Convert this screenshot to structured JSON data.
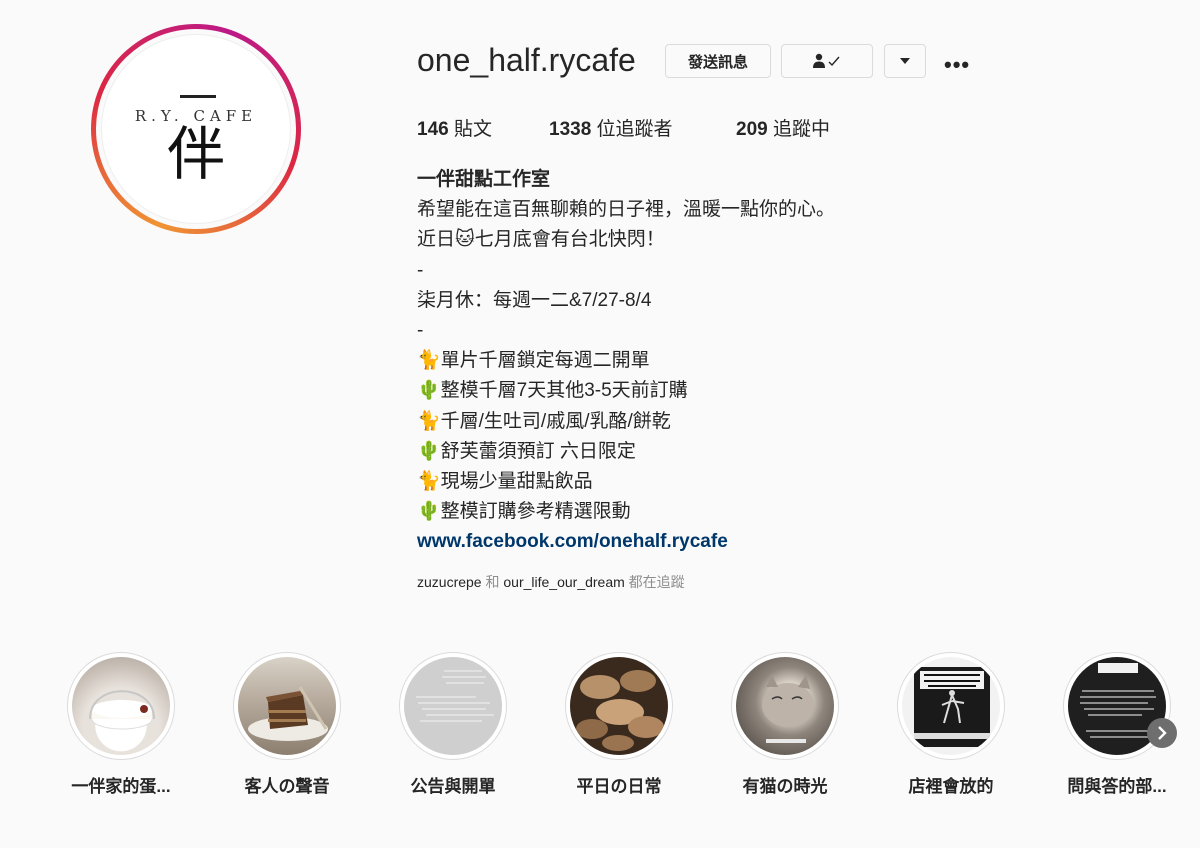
{
  "profile": {
    "username": "one_half.rycafe",
    "avatar_text": {
      "brand": "R.Y. CAFE",
      "char": "伴"
    },
    "buttons": {
      "message": "發送訊息",
      "following_icon": "person-check-icon",
      "dropdown_icon": "triangle-down-icon",
      "more_icon": "more-dots-icon",
      "more_glyph": "•••"
    },
    "stats": {
      "posts_count": "146",
      "posts_label": " 貼文",
      "followers_count": "1338",
      "followers_label": " 位追蹤者",
      "following_count": "209",
      "following_label": " 追蹤中"
    },
    "bio": {
      "name": "一伴甜點工作室",
      "lines": [
        "希望能在這百無聊賴的日子裡，溫暖一點你的心。",
        "近日🐱七月底會有台北快閃！",
        "-",
        "柒月休：每週一二&7/27-8/4",
        "-",
        "🐈單片千層鎖定每週二開單",
        "🌵整模千層7天其他3-5天前訂購",
        "🐈千層/生吐司/戚風/乳酪/餅乾",
        "🌵舒芙蕾須預訂 六日限定",
        "🐈現場少量甜點飲品",
        "🌵整模訂購參考精選限動"
      ],
      "link": "www.facebook.com/onehalf.rycafe"
    },
    "followed_by": {
      "user1": "zuzucrepe",
      "and": " 和 ",
      "user2": "our_life_our_dream",
      "suffix": " 都在追蹤"
    }
  },
  "highlights": [
    {
      "label": "一伴家的蛋...",
      "image": "cake-under-glass-dome"
    },
    {
      "label": "客人の聲音",
      "image": "chocolate-cake-slice"
    },
    {
      "label": "公告與開單",
      "image": "announcement-text-gray"
    },
    {
      "label": "平日の日常",
      "image": "mushrooms"
    },
    {
      "label": "有猫の時光",
      "image": "sleeping-cat"
    },
    {
      "label": "店裡會放的",
      "image": "album-cover-black-parade"
    },
    {
      "label": "問與答的部...",
      "image": "qa-text-dark"
    }
  ],
  "colors": {
    "story_ring": [
      "#f09433",
      "#dc2743",
      "#bc1888"
    ],
    "link": "#00376b",
    "muted": "#8e8e8e"
  },
  "next_arrow_icon": "chevron-right-icon"
}
